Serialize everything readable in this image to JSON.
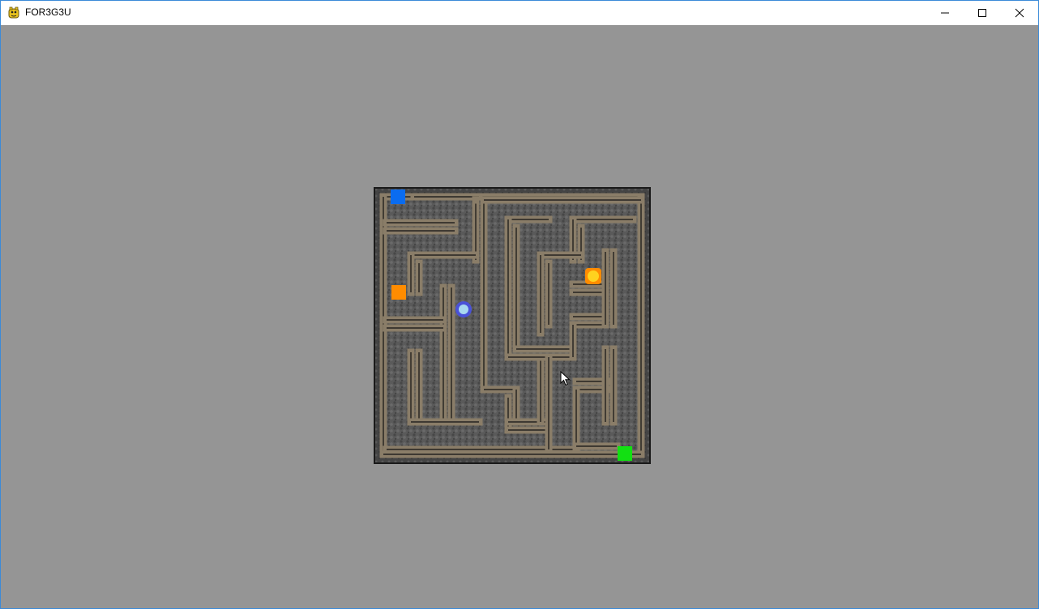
{
  "window": {
    "title": "FOR3G3U",
    "icon": "python-game-icon",
    "controls": [
      "minimize-icon",
      "maximize-icon",
      "close-icon"
    ]
  },
  "colors": {
    "background": "#959595",
    "outer_wall": "#4a4a4a",
    "floor": "#5a5a5a",
    "wall": "#8a7d68",
    "wall_edge": "#111111",
    "start_marker": "#0a6cf0",
    "goal_marker": "#12e012",
    "key_marker": "#ff8c00",
    "player": "#4a52d8",
    "player_inner": "#a8d8f0",
    "coin": "#ff8c00",
    "coin_inner": "#ffd21f"
  },
  "maze": {
    "entities": [
      "start-marker",
      "goal-marker",
      "key-marker",
      "player-token",
      "coin-token"
    ]
  }
}
